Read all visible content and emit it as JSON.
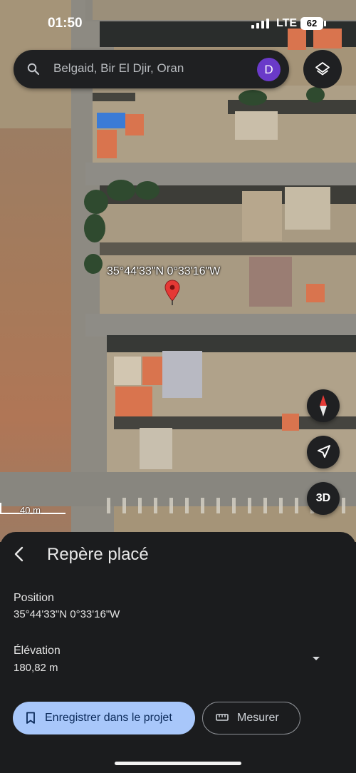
{
  "status_bar": {
    "time": "01:50",
    "network": "LTE",
    "battery": "62"
  },
  "search": {
    "query": "Belgaid, Bir El Djir, Oran",
    "avatar_letter": "D"
  },
  "map": {
    "pin_coordinates": "35°44'33\"N 0°33'16\"W",
    "scale": "40 m"
  },
  "controls": {
    "three_d_label": "3D"
  },
  "sheet": {
    "title": "Repère placé",
    "position_label": "Position",
    "position_value": "35°44'33\"N 0°33'16\"W",
    "elevation_label": "Élévation",
    "elevation_value": "180,82 m",
    "save_label": "Enregistrer dans le projet",
    "measure_label": "Mesurer"
  },
  "colors": {
    "accent": "#a8c7fa",
    "avatar": "#6a3ac9",
    "pin": "#e53935",
    "sheet_bg": "#1b1c1e"
  }
}
